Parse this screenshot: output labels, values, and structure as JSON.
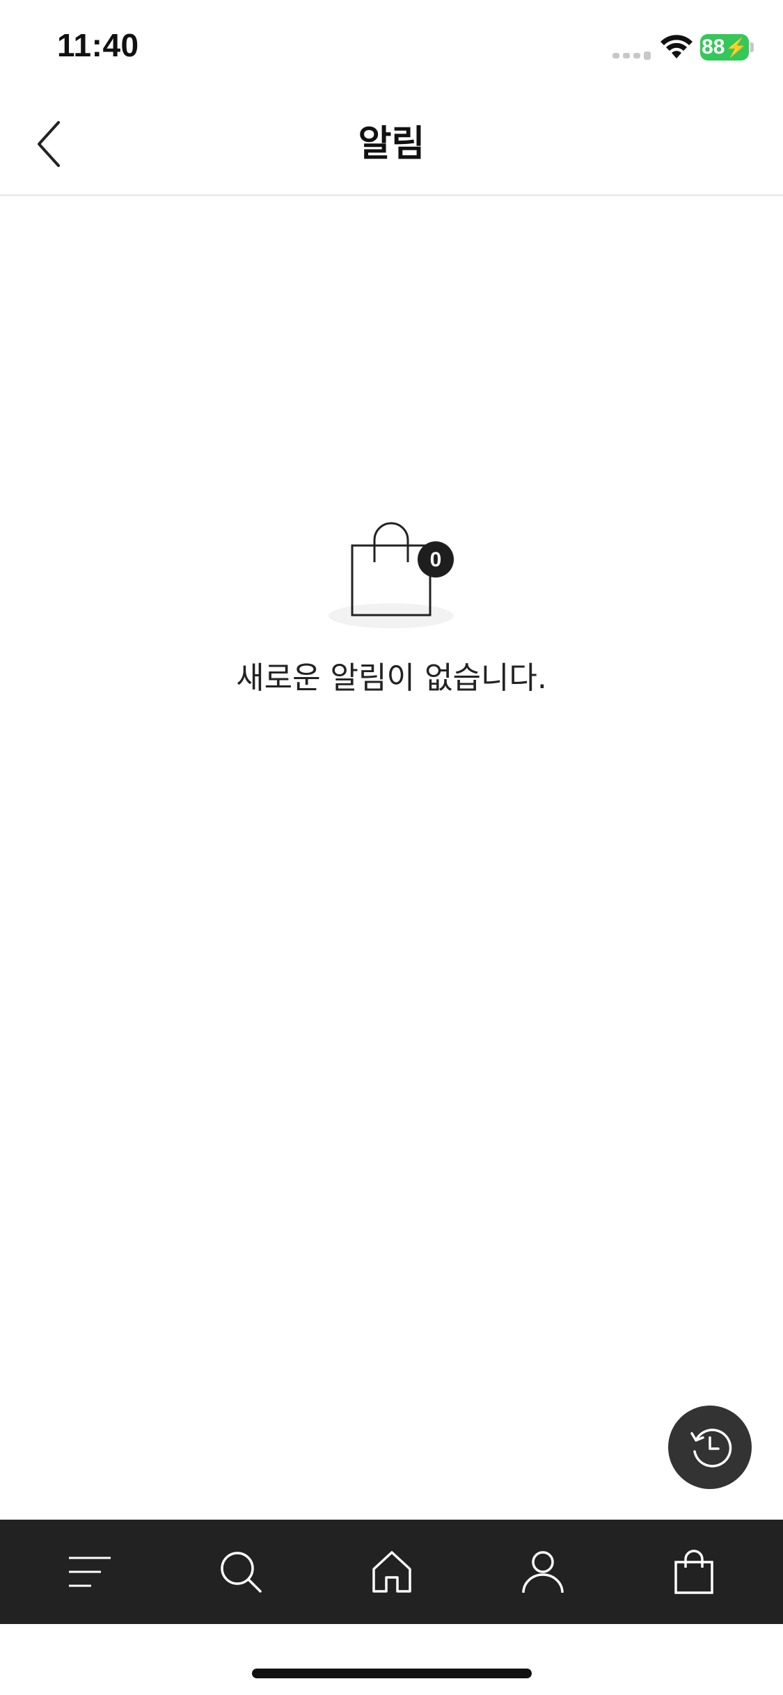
{
  "status_bar": {
    "time": "11:40",
    "battery_level": "88",
    "battery_color": "#34c759"
  },
  "header": {
    "title": "알림",
    "back_icon": "chevron-left-icon"
  },
  "empty_state": {
    "icon": "shopping-bag-icon",
    "badge_count": "0",
    "message": "새로운 알림이 없습니다."
  },
  "fab": {
    "icon": "history-clock-icon"
  },
  "bottom_nav": {
    "background": "#222222",
    "items": [
      {
        "name": "menu",
        "icon": "menu-icon"
      },
      {
        "name": "search",
        "icon": "search-icon"
      },
      {
        "name": "home",
        "icon": "home-icon"
      },
      {
        "name": "my-page",
        "icon": "user-icon"
      },
      {
        "name": "cart",
        "icon": "shopping-bag-icon"
      }
    ]
  }
}
